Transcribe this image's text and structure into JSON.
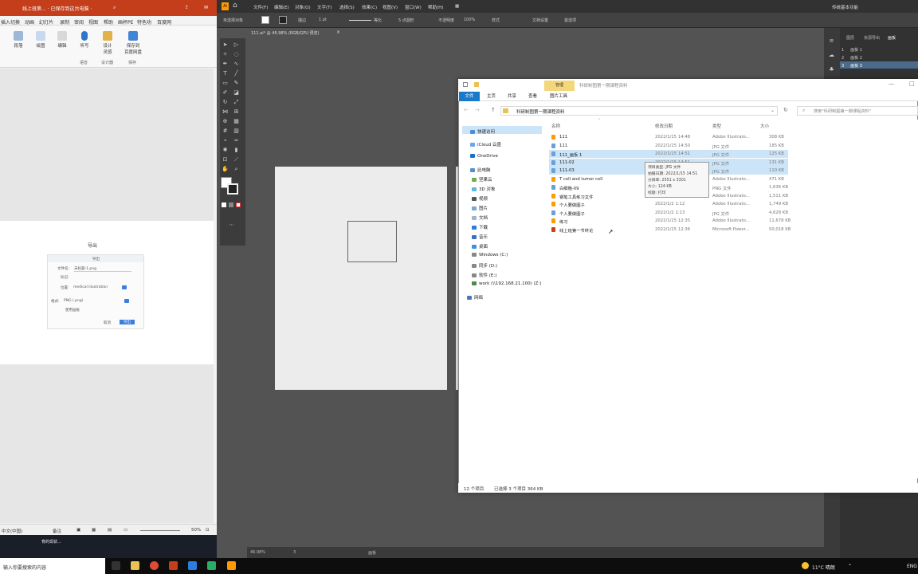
{
  "ppt": {
    "title": "线上班第... · 已保存到这台电脑 ·",
    "menu": [
      "插入",
      "切换",
      "动画",
      "幻灯片",
      "录制",
      "审阅",
      "视图",
      "帮助",
      "画杯PE",
      "特色功",
      "百度网"
    ],
    "ribbon": {
      "btn1": "段落",
      "btn2": "绘图",
      "btn3": "编辑",
      "btn4": "听写",
      "btn5": "设计\n灵感",
      "btn6": "保存到\n百度网盘",
      "group1": "语音",
      "group2": "设计器",
      "group3": "保存"
    },
    "export": {
      "title": "导出",
      "dialog_header": "导出",
      "filename_label": "文件名:",
      "filename_value": "未标题-1.png",
      "tags_label": "标记:",
      "location_label": "位置:",
      "location_value": "medical illustration",
      "format_label": "格式:",
      "format_value": "PNG (.png)",
      "more_options": "使用画板",
      "cancel": "取消",
      "export_btn": "导出"
    },
    "status": {
      "lang": "中文(中国)",
      "notes": "备注",
      "zoom": "50%"
    },
    "desk_text": "育的现状..."
  },
  "ai": {
    "menu": [
      "文件(F)",
      "编辑(E)",
      "对象(O)",
      "文字(T)",
      "选择(S)",
      "效果(C)",
      "视图(V)",
      "窗口(W)",
      "帮助(H)"
    ],
    "control": {
      "no_selection": "未选择对象",
      "stroke": "描边",
      "stroke_val": "1 pt",
      "brush": "等比",
      "dots": "5 点圆形",
      "opacity_label": "不透明度",
      "opacity_val": "100%",
      "style": "样式",
      "doc_setup": "文档设置",
      "prefs": "首选项"
    },
    "tab": "111.ai* @ 46.98% (RGB/GPU 预览)",
    "right_search": "传统基本功能",
    "panels": {
      "tabs": [
        "图层",
        "资源导出",
        "画板"
      ],
      "artboards": [
        "画板 1",
        "画板 2",
        "画板 3"
      ]
    },
    "status": {
      "zoom": "46.98%",
      "page": "3",
      "mode": "画板"
    }
  },
  "explorer": {
    "manage_tab": "管理",
    "title": "科研制图第一期课程资料",
    "tabs": [
      "文件",
      "主页",
      "共享",
      "查看",
      "图片工具"
    ],
    "address": "科研制图第一期课程资料",
    "search_placeholder": "搜索\"科研制图第一期课程资料\"",
    "nav": [
      "快速访问",
      "iCloud 云盘",
      "OneDrive",
      "此电脑",
      "坚果云",
      "3D 对象",
      "视频",
      "图片",
      "文档",
      "下载",
      "音乐",
      "桌面",
      "Windows (C:)",
      "同步 (D:)",
      "软件 (E:)",
      "work (\\\\192.168.21.100) (Z:)",
      "网络"
    ],
    "columns": {
      "name": "名称",
      "date": "修改日期",
      "type": "类型",
      "size": "大小"
    },
    "files": [
      {
        "name": "111",
        "date": "2022/1/15 14:48",
        "type": "Adobe Illustrato...",
        "size": "308 KB"
      },
      {
        "name": "111",
        "date": "2022/1/15 14:50",
        "type": "JPG 文件",
        "size": "185 KB"
      },
      {
        "name": "111_画板 1",
        "date": "2022/1/15 14:51",
        "type": "JPG 文件",
        "size": "125 KB"
      },
      {
        "name": "111-02",
        "date": "2022/1/15 14:51",
        "type": "JPG 文件",
        "size": "131 KB"
      },
      {
        "name": "111-03",
        "date": "2022/1/15 14:51",
        "type": "JPG 文件",
        "size": "110 KB"
      },
      {
        "name": "T cell and tumor cell",
        "date": "2022/1/15 14:51",
        "type": "Adobe Illustrato...",
        "size": "471 KB"
      },
      {
        "name": "白细胞-09",
        "date": "2022/1/15 14:51",
        "type": "PNG 文件",
        "size": "1,636 KB"
      },
      {
        "name": "钢笔工具练习文件",
        "date": "2022/1/15 14:51",
        "type": "Adobe Illustrato...",
        "size": "1,511 KB"
      },
      {
        "name": "个人要做图子",
        "date": "2022/1/2 1:12",
        "type": "Adobe Illustrato...",
        "size": "1,749 KB"
      },
      {
        "name": "个人要做图子",
        "date": "2022/1/2 1:13",
        "type": "JPG 文件",
        "size": "4,628 KB"
      },
      {
        "name": "练习",
        "date": "2022/1/15 12:35",
        "type": "Adobe Illustrato...",
        "size": "11,678 KB"
      },
      {
        "name": "线上班第一节终论",
        "date": "2022/1/15 12:36",
        "type": "Microsoft Power...",
        "size": "50,018 KB"
      }
    ],
    "tooltip": [
      "项目类型: JPG 文件",
      "拍摄日期: 2022/1/15 14:51",
      "分辨率: 2551 x 3301",
      "大小: 124 KB",
      "标题: 打印"
    ],
    "status": {
      "count": "12 个项目",
      "selected": "已选择 3 个项目  364 KB"
    }
  },
  "taskbar": {
    "search": "输入你要搜索的内容",
    "weather": "11°C 晴朗",
    "lang": "ENG"
  }
}
